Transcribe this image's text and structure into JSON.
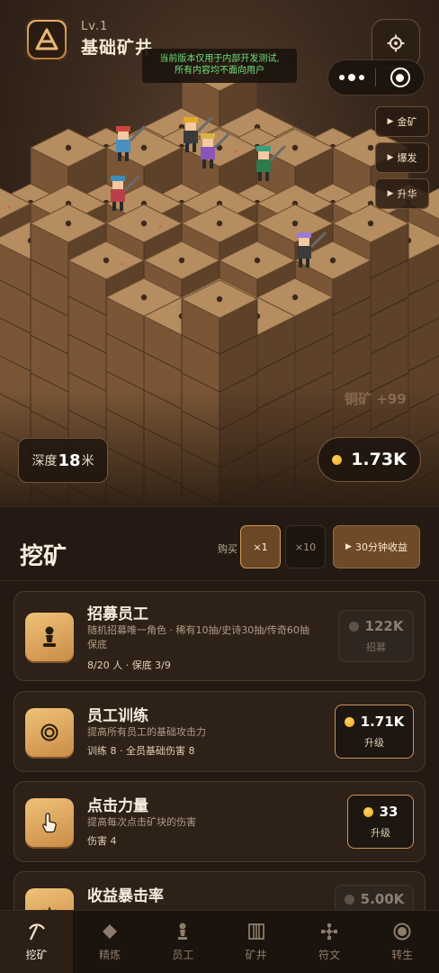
{
  "header": {
    "level": "Lv.1",
    "mine_name": "基础矿井",
    "dev_notice_line1": "当前版本仅用于内部开发测试,",
    "dev_notice_line2": "所有内容均不面向用户"
  },
  "side_buttons": [
    {
      "label": "金矿"
    },
    {
      "label": "爆发"
    },
    {
      "label": "升华"
    }
  ],
  "floating_text": "铜矿 +99",
  "depth": {
    "label": "深度",
    "value": "18",
    "unit": "米"
  },
  "gold": {
    "value": "1.73K"
  },
  "panel": {
    "title": "挖矿",
    "buy_label": "购买",
    "mult_x1": "×1",
    "mult_x10": "×10",
    "income_30": "30分钟收益"
  },
  "cards": [
    {
      "name": "招募员工",
      "desc_line1": "随机招募唯一角色 · 稀有10抽/史诗30抽/传奇60抽",
      "desc_line2": "保底",
      "sub": "8/20 人 · 保底 3/9",
      "price": "122K",
      "action": "招募",
      "icon": "pawn-icon",
      "enabled": false
    },
    {
      "name": "员工训练",
      "desc_line1": "提高所有员工的基础攻击力",
      "sub": "训练 8 · 全员基础伤害 8",
      "price": "1.71K",
      "action": "升级",
      "icon": "target-icon",
      "enabled": true
    },
    {
      "name": "点击力量",
      "desc_line1": "提高每次点击矿块的伤害",
      "sub": "伤害 4",
      "price": "33",
      "action": "升级",
      "icon": "pointer-icon",
      "enabled": true
    },
    {
      "name": "收益暴击率",
      "desc_line1": "",
      "sub": "",
      "price": "5.00K",
      "action": "",
      "icon": "crown-icon",
      "enabled": false
    }
  ],
  "tabs": [
    {
      "label": "挖矿",
      "icon": "pickaxe-icon",
      "active": true
    },
    {
      "label": "精炼",
      "icon": "diamond-icon",
      "active": false
    },
    {
      "label": "员工",
      "icon": "pawn-icon",
      "active": false
    },
    {
      "label": "矿井",
      "icon": "mine-shaft-icon",
      "active": false
    },
    {
      "label": "符文",
      "icon": "rune-icon",
      "active": false
    },
    {
      "label": "转生",
      "icon": "rebirth-icon",
      "active": false
    }
  ],
  "colors": {
    "accent": "#d09a5a",
    "gold": "#f0a21c",
    "notice_text": "#6fe07a"
  }
}
